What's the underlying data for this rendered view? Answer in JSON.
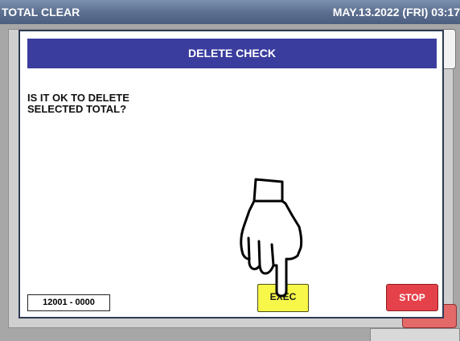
{
  "titlebar": {
    "app_title": "TOTAL CLEAR",
    "datetime": "MAY.13.2022 (FRI)  03:17"
  },
  "dialog": {
    "title": "DELETE CHECK",
    "message_line1": "IS IT OK TO DELETE",
    "message_line2": "SELECTED TOTAL?",
    "code": "12001 - 0000",
    "exec_label": "EXEC",
    "stop_label": "STOP"
  },
  "colors": {
    "titlebar": "#5a6d8e",
    "dialog_header": "#3a3d9e",
    "exec_button": "#f7f74a",
    "stop_button": "#e5414a"
  },
  "icons": {
    "pointer": "pointing-hand-icon"
  }
}
